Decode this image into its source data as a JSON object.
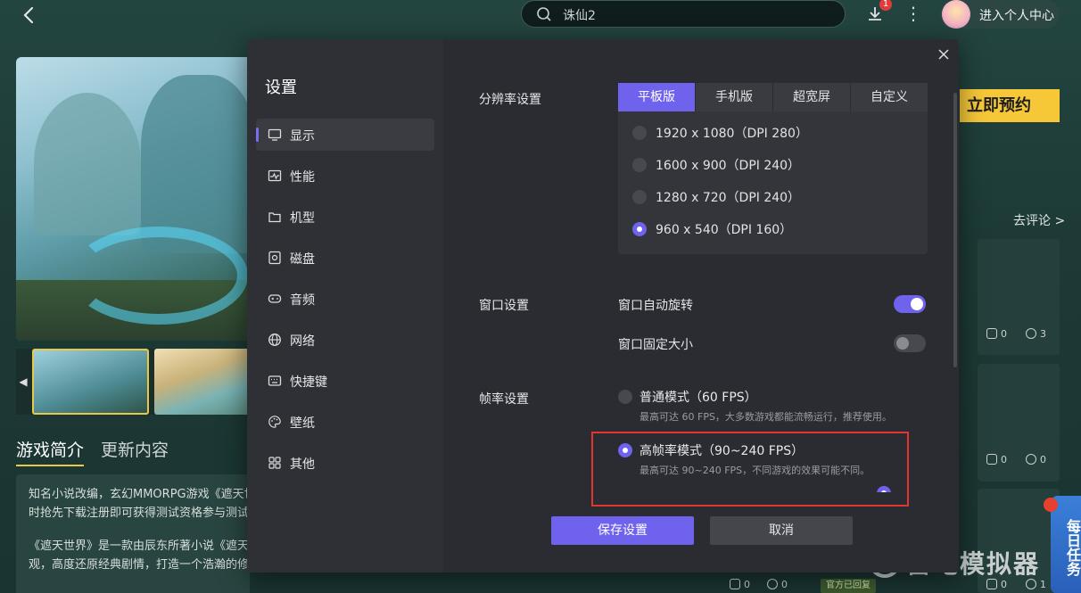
{
  "topbar": {
    "search_value": "诛仙2",
    "download_badge": "1",
    "user_center_label": "进入个人中心"
  },
  "game_page": {
    "tabs": [
      "游戏简介",
      "更新内容"
    ],
    "intro_lines": [
      "知名小说改编，玄幻MMORPG游戏《遮天世",
      "时抢先下载注册即可获得测试资格参与测试",
      "《遮天世界》是一款由辰东所著小说《遮天",
      "观，高度还原经典剧情，打造一个浩瀚的修仙世界。"
    ],
    "preorder_label": "立即预约",
    "go_comment_label": "去评论 >",
    "cards": [
      {
        "likes": "0",
        "comments": "3"
      },
      {
        "likes": "0",
        "comments": "0"
      },
      {
        "likes": "0",
        "comments": "1"
      }
    ],
    "bottom_likes": "0",
    "bottom_comments": "0",
    "official_reply_badge": "官方已回复",
    "daily_task_label": "每日任务",
    "watermark_text": "雷电模拟器"
  },
  "settings": {
    "title": "设置",
    "nav": [
      {
        "label": "显示",
        "icon": "monitor-icon",
        "active": true
      },
      {
        "label": "性能",
        "icon": "performance-icon",
        "active": false
      },
      {
        "label": "机型",
        "icon": "device-model-icon",
        "active": false
      },
      {
        "label": "磁盘",
        "icon": "disk-icon",
        "active": false
      },
      {
        "label": "音频",
        "icon": "gamepad-icon",
        "active": false
      },
      {
        "label": "网络",
        "icon": "globe-icon",
        "active": false
      },
      {
        "label": "快捷键",
        "icon": "keyboard-icon",
        "active": false
      },
      {
        "label": "壁纸",
        "icon": "palette-icon",
        "active": false
      },
      {
        "label": "其他",
        "icon": "grid-icon",
        "active": false
      }
    ],
    "resolution": {
      "label": "分辨率设置",
      "tabs": [
        "平板版",
        "手机版",
        "超宽屏",
        "自定义"
      ],
      "active_tab": 0,
      "options": [
        "1920 x 1080（DPI 280）",
        "1600 x 900（DPI 240）",
        "1280 x 720（DPI 240）",
        "960 x 540（DPI 160）"
      ],
      "selected": 3
    },
    "window": {
      "label": "窗口设置",
      "auto_rotate_label": "窗口自动旋转",
      "auto_rotate_on": true,
      "fixed_size_label": "窗口固定大小",
      "fixed_size_on": false
    },
    "framerate": {
      "label": "帧率设置",
      "normal_label": "普通模式（60 FPS）",
      "normal_desc": "最高可达 60 FPS，大多数游戏都能流畅运行，推荐使用。",
      "high_label": "高帧率模式（90~240 FPS）",
      "high_desc": "最高可达 90~240 FPS，不同游戏的效果可能不同。",
      "selected": "high"
    },
    "save_label": "保存设置",
    "cancel_label": "取消"
  },
  "colors": {
    "accent": "#6f63ee",
    "highlight_box": "#e0362f",
    "preorder_yellow": "#f6c838"
  }
}
